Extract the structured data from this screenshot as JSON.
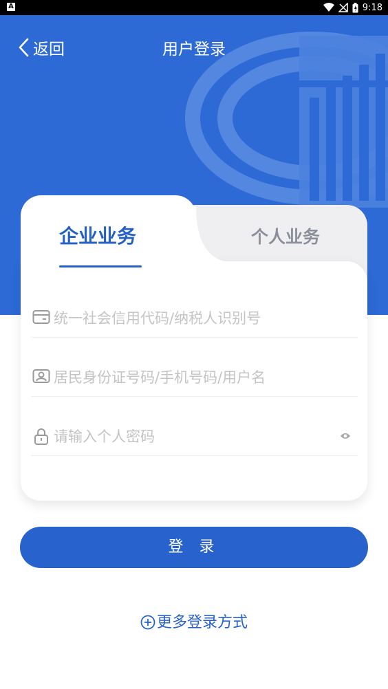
{
  "status_bar": {
    "time": "9:18",
    "left_badge": "A"
  },
  "header": {
    "back_label": "返回",
    "title": "用户登录"
  },
  "tabs": [
    {
      "label": "企业业务",
      "active": true
    },
    {
      "label": "个人业务",
      "active": false
    }
  ],
  "form": {
    "credit_code_placeholder": "统一社会信用代码/纳税人识别号",
    "id_placeholder": "居民身份证号码/手机号码/用户名",
    "password_placeholder": "请输入个人密码"
  },
  "login_button": "登 录",
  "more_methods": "更多登录方式",
  "colors": {
    "primary": "#2d6ad5",
    "accent_text": "#2561c5",
    "inactive_tab": "#efeff1"
  }
}
